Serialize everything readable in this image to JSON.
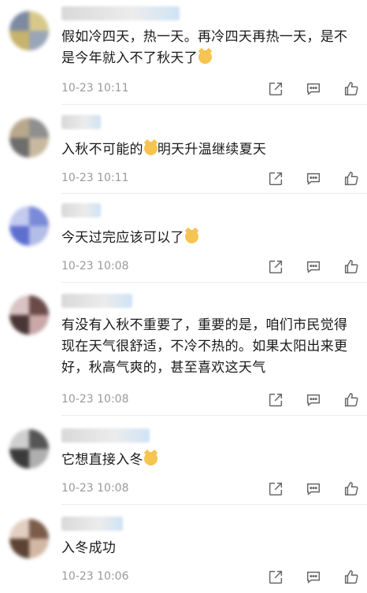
{
  "comments": [
    {
      "text": "假如冷四天，热一天。再冷四天再热一天，是不是今年就入不了秋天了",
      "emoji": true,
      "time": "10-23 10:11"
    },
    {
      "text": "入秋不可能的",
      "emoji_mid": true,
      "text_after": "明天升温继续夏天",
      "time": "10-23 10:11"
    },
    {
      "text": "今天过完应该可以了",
      "emoji": true,
      "time": "10-23 10:08"
    },
    {
      "text": "有没有入秋不重要了，重要的是，咱们市民觉得现在天气很舒适，不冷不热的。如果太阳出来更好，秋高气爽的，甚至喜欢这天气",
      "emoji": false,
      "time": "10-23 10:08"
    },
    {
      "text": "它想直接入冬",
      "emoji": true,
      "time": "10-23 10:08"
    },
    {
      "text": "入冬成功",
      "emoji": false,
      "time": "10-23 10:06"
    }
  ],
  "icons": {
    "share": "share-icon",
    "reply": "comment-icon",
    "like": "thumbs-up-icon"
  },
  "colors": {
    "text": "#1a1a1a",
    "meta": "#9a9a9a",
    "icon": "#666666"
  }
}
